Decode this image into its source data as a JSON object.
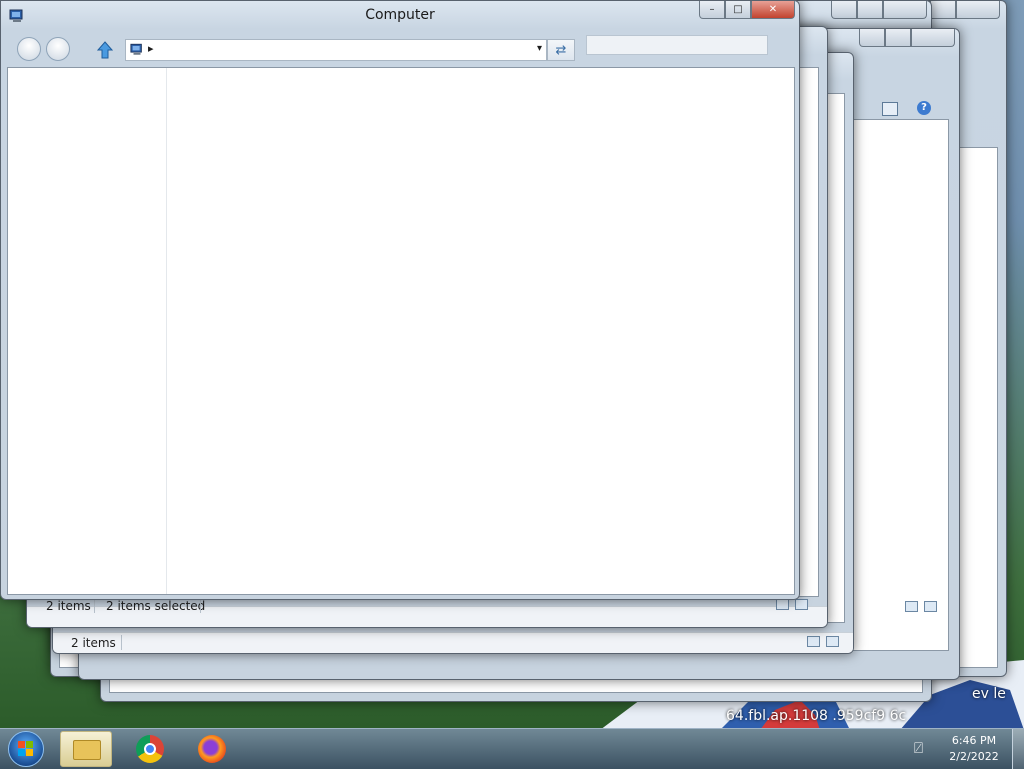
{
  "desktop": {
    "wallpaper_text_1": "64.fbl.ap.1108  .959cf9  6c",
    "wallpaper_text_2": "ev le"
  },
  "main_window": {
    "title": "Computer",
    "caption_minimize": "–",
    "caption_maximize": "□",
    "caption_close": "✕",
    "address_arrow": "▸",
    "address_dropdown": "▾",
    "refresh_icon": "⇄",
    "search_placeholder": "",
    "status_count": "2 items",
    "status_selected": "2 items selected"
  },
  "background_windows": {
    "status_count_2": "2 items"
  },
  "taskbar": {
    "time": "6:46 PM",
    "date": "2/2/2022",
    "network_icon": "⍁"
  },
  "colors": {
    "close_red": "#c2432f",
    "accent_blue": "#3a6ea5"
  }
}
